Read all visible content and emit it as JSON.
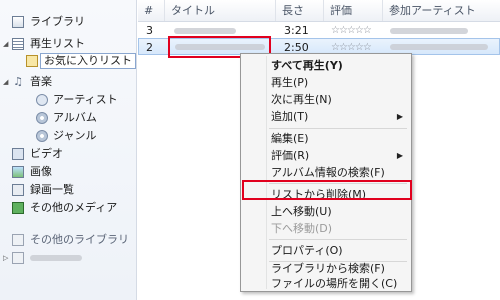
{
  "sidebar": {
    "items": [
      {
        "label": "ライブラリ",
        "icon": "library-icon"
      },
      {
        "label": "再生リスト",
        "icon": "playlist-icon",
        "expander": "◢"
      },
      {
        "label": "お気に入りリスト",
        "icon": "favorites-playlist-icon",
        "selected": true
      },
      {
        "label": "音楽",
        "icon": "music-note-icon",
        "expander": "◢"
      },
      {
        "label": "アーティスト",
        "icon": "artist-icon"
      },
      {
        "label": "アルバム",
        "icon": "album-icon"
      },
      {
        "label": "ジャンル",
        "icon": "genre-icon"
      },
      {
        "label": "ビデオ",
        "icon": "video-icon"
      },
      {
        "label": "画像",
        "icon": "picture-icon"
      },
      {
        "label": "録画一覧",
        "icon": "recorded-tv-icon"
      },
      {
        "label": "その他のメディア",
        "icon": "other-media-icon"
      },
      {
        "label": "その他のライブラリ",
        "icon": "other-libraries-icon"
      },
      {
        "label": "",
        "icon": "user-library-icon",
        "expander": "▷"
      }
    ]
  },
  "table": {
    "columns": [
      "#",
      "タイトル",
      "長さ",
      "評価",
      "参加アーティスト"
    ],
    "rows": [
      {
        "num": "3",
        "length": "3:21",
        "rating": "☆☆☆☆☆"
      },
      {
        "num": "2",
        "length": "2:50",
        "rating": "☆☆☆☆☆",
        "selected": true
      }
    ]
  },
  "context_menu": {
    "items": [
      {
        "label": "すべて再生(Y)",
        "bold": true
      },
      {
        "label": "再生(P)"
      },
      {
        "label": "次に再生(N)"
      },
      {
        "label": "追加(T)",
        "submenu": "▶"
      },
      {
        "separator": true
      },
      {
        "label": "編集(E)"
      },
      {
        "label": "評価(R)",
        "submenu": "▶"
      },
      {
        "label": "アルバム情報の検索(F)"
      },
      {
        "separator": true
      },
      {
        "label": "リストから削除(M)",
        "highlighted": true
      },
      {
        "label": "上へ移動(U)"
      },
      {
        "label": "下へ移動(D)",
        "disabled": true
      },
      {
        "separator": true
      },
      {
        "label": "プロパティ(O)"
      },
      {
        "separator": true
      },
      {
        "label": "ライブラリから検索(F)"
      },
      {
        "label": "ファイルの場所を開く(C)"
      }
    ]
  },
  "colors": {
    "highlight_box": "#e1001e",
    "selection": "#d7e8fb"
  }
}
